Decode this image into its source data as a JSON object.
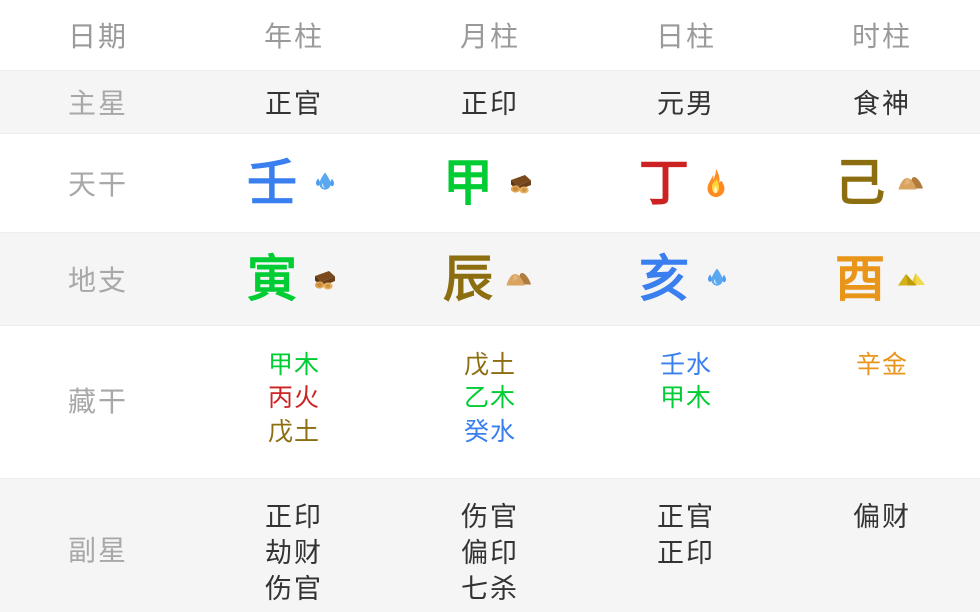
{
  "colors": {
    "wood": "#00cc33",
    "fire": "#cc2222",
    "earth": "#8c6d10",
    "metal": "#e8951a",
    "water": "#3a7ff0",
    "label": "#a8a8a8",
    "text": "#333333",
    "row_gray": "#f5f5f5",
    "row_white": "#ffffff"
  },
  "table": {
    "header": {
      "label": "日期",
      "columns": [
        "年柱",
        "月柱",
        "日柱",
        "时柱"
      ]
    },
    "main_star": {
      "label": "主星",
      "values": [
        "正官",
        "正印",
        "元男",
        "食神"
      ]
    },
    "heavenly_stems": {
      "label": "天干",
      "cells": [
        {
          "char": "壬",
          "color": "#3a7ff0",
          "element": "water",
          "icon": "water-drops-icon"
        },
        {
          "char": "甲",
          "color": "#00cc33",
          "element": "wood",
          "icon": "wood-log-icon"
        },
        {
          "char": "丁",
          "color": "#cc2222",
          "element": "fire",
          "icon": "fire-icon"
        },
        {
          "char": "己",
          "color": "#8c6d10",
          "element": "earth",
          "icon": "earth-mounds-icon"
        }
      ]
    },
    "earthly_branches": {
      "label": "地支",
      "cells": [
        {
          "char": "寅",
          "color": "#00cc33",
          "element": "wood",
          "icon": "wood-log-icon"
        },
        {
          "char": "辰",
          "color": "#8c6d10",
          "element": "earth",
          "icon": "earth-mounds-icon"
        },
        {
          "char": "亥",
          "color": "#3a7ff0",
          "element": "water",
          "icon": "water-drops-icon"
        },
        {
          "char": "酉",
          "color": "#e8951a",
          "element": "metal",
          "icon": "metal-peaks-icon"
        }
      ]
    },
    "hidden_stems": {
      "label": "藏干",
      "columns": [
        [
          {
            "text": "甲木",
            "color": "#00cc33"
          },
          {
            "text": "丙火",
            "color": "#cc2222"
          },
          {
            "text": "戊土",
            "color": "#8c6d10"
          }
        ],
        [
          {
            "text": "戊土",
            "color": "#8c6d10"
          },
          {
            "text": "乙木",
            "color": "#00cc33"
          },
          {
            "text": "癸水",
            "color": "#3a7ff0"
          }
        ],
        [
          {
            "text": "壬水",
            "color": "#3a7ff0"
          },
          {
            "text": "甲木",
            "color": "#00cc33"
          }
        ],
        [
          {
            "text": "辛金",
            "color": "#e8951a"
          }
        ]
      ]
    },
    "secondary_stars": {
      "label": "副星",
      "columns": [
        [
          "正印",
          "劫财",
          "伤官"
        ],
        [
          "伤官",
          "偏印",
          "七杀"
        ],
        [
          "正官",
          "正印"
        ],
        [
          "偏财"
        ]
      ]
    }
  }
}
